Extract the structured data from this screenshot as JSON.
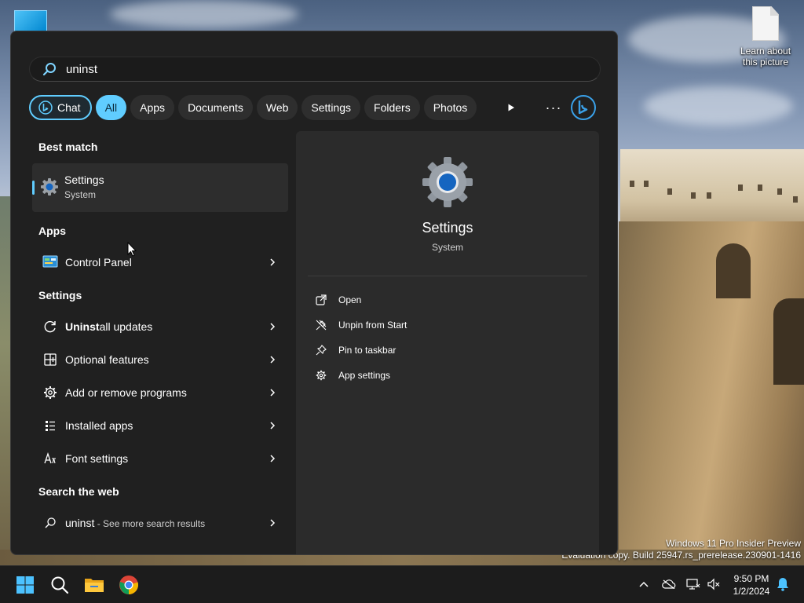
{
  "desktop": {
    "learn_about_label": "Learn about this picture",
    "watermark_line1": "Windows 11 Pro Insider Preview",
    "watermark_line2": "Evaluation copy. Build 25947.rs_prerelease.230901-1416"
  },
  "search": {
    "query": "uninst",
    "icon": "search-icon"
  },
  "filters": {
    "chat": "Chat",
    "all": "All",
    "apps": "Apps",
    "documents": "Documents",
    "web": "Web",
    "settings": "Settings",
    "folders": "Folders",
    "photos": "Photos",
    "more": "···",
    "active": "All",
    "accent": "#60cdff"
  },
  "best_match": {
    "title": "Best match",
    "item": {
      "name": "Settings",
      "sub": "System",
      "icon": "settings-gear-icon"
    }
  },
  "apps": {
    "title": "Apps",
    "items": [
      {
        "name": "Control Panel",
        "icon": "control-panel-icon"
      }
    ]
  },
  "settings_section": {
    "title": "Settings",
    "items": [
      {
        "bold": "Uninst",
        "rest": "all updates",
        "icon": "refresh-icon"
      },
      {
        "bold": "",
        "rest": "Optional features",
        "icon": "grid-plus-icon"
      },
      {
        "bold": "",
        "rest": "Add or remove programs",
        "icon": "gear-icon"
      },
      {
        "bold": "",
        "rest": "Installed apps",
        "icon": "list-icon"
      },
      {
        "bold": "",
        "rest": "Font settings",
        "icon": "font-icon"
      }
    ]
  },
  "web": {
    "title": "Search the web",
    "query": "uninst",
    "suffix": " - See more search results"
  },
  "preview": {
    "title": "Settings",
    "subtitle": "System",
    "actions": [
      {
        "label": "Open",
        "icon": "open-external-icon"
      },
      {
        "label": "Unpin from Start",
        "icon": "unpin-icon"
      },
      {
        "label": "Pin to taskbar",
        "icon": "pin-icon"
      },
      {
        "label": "App settings",
        "icon": "gear-icon"
      }
    ]
  },
  "taskbar": {
    "time": "9:50 PM",
    "date": "1/2/2024"
  }
}
